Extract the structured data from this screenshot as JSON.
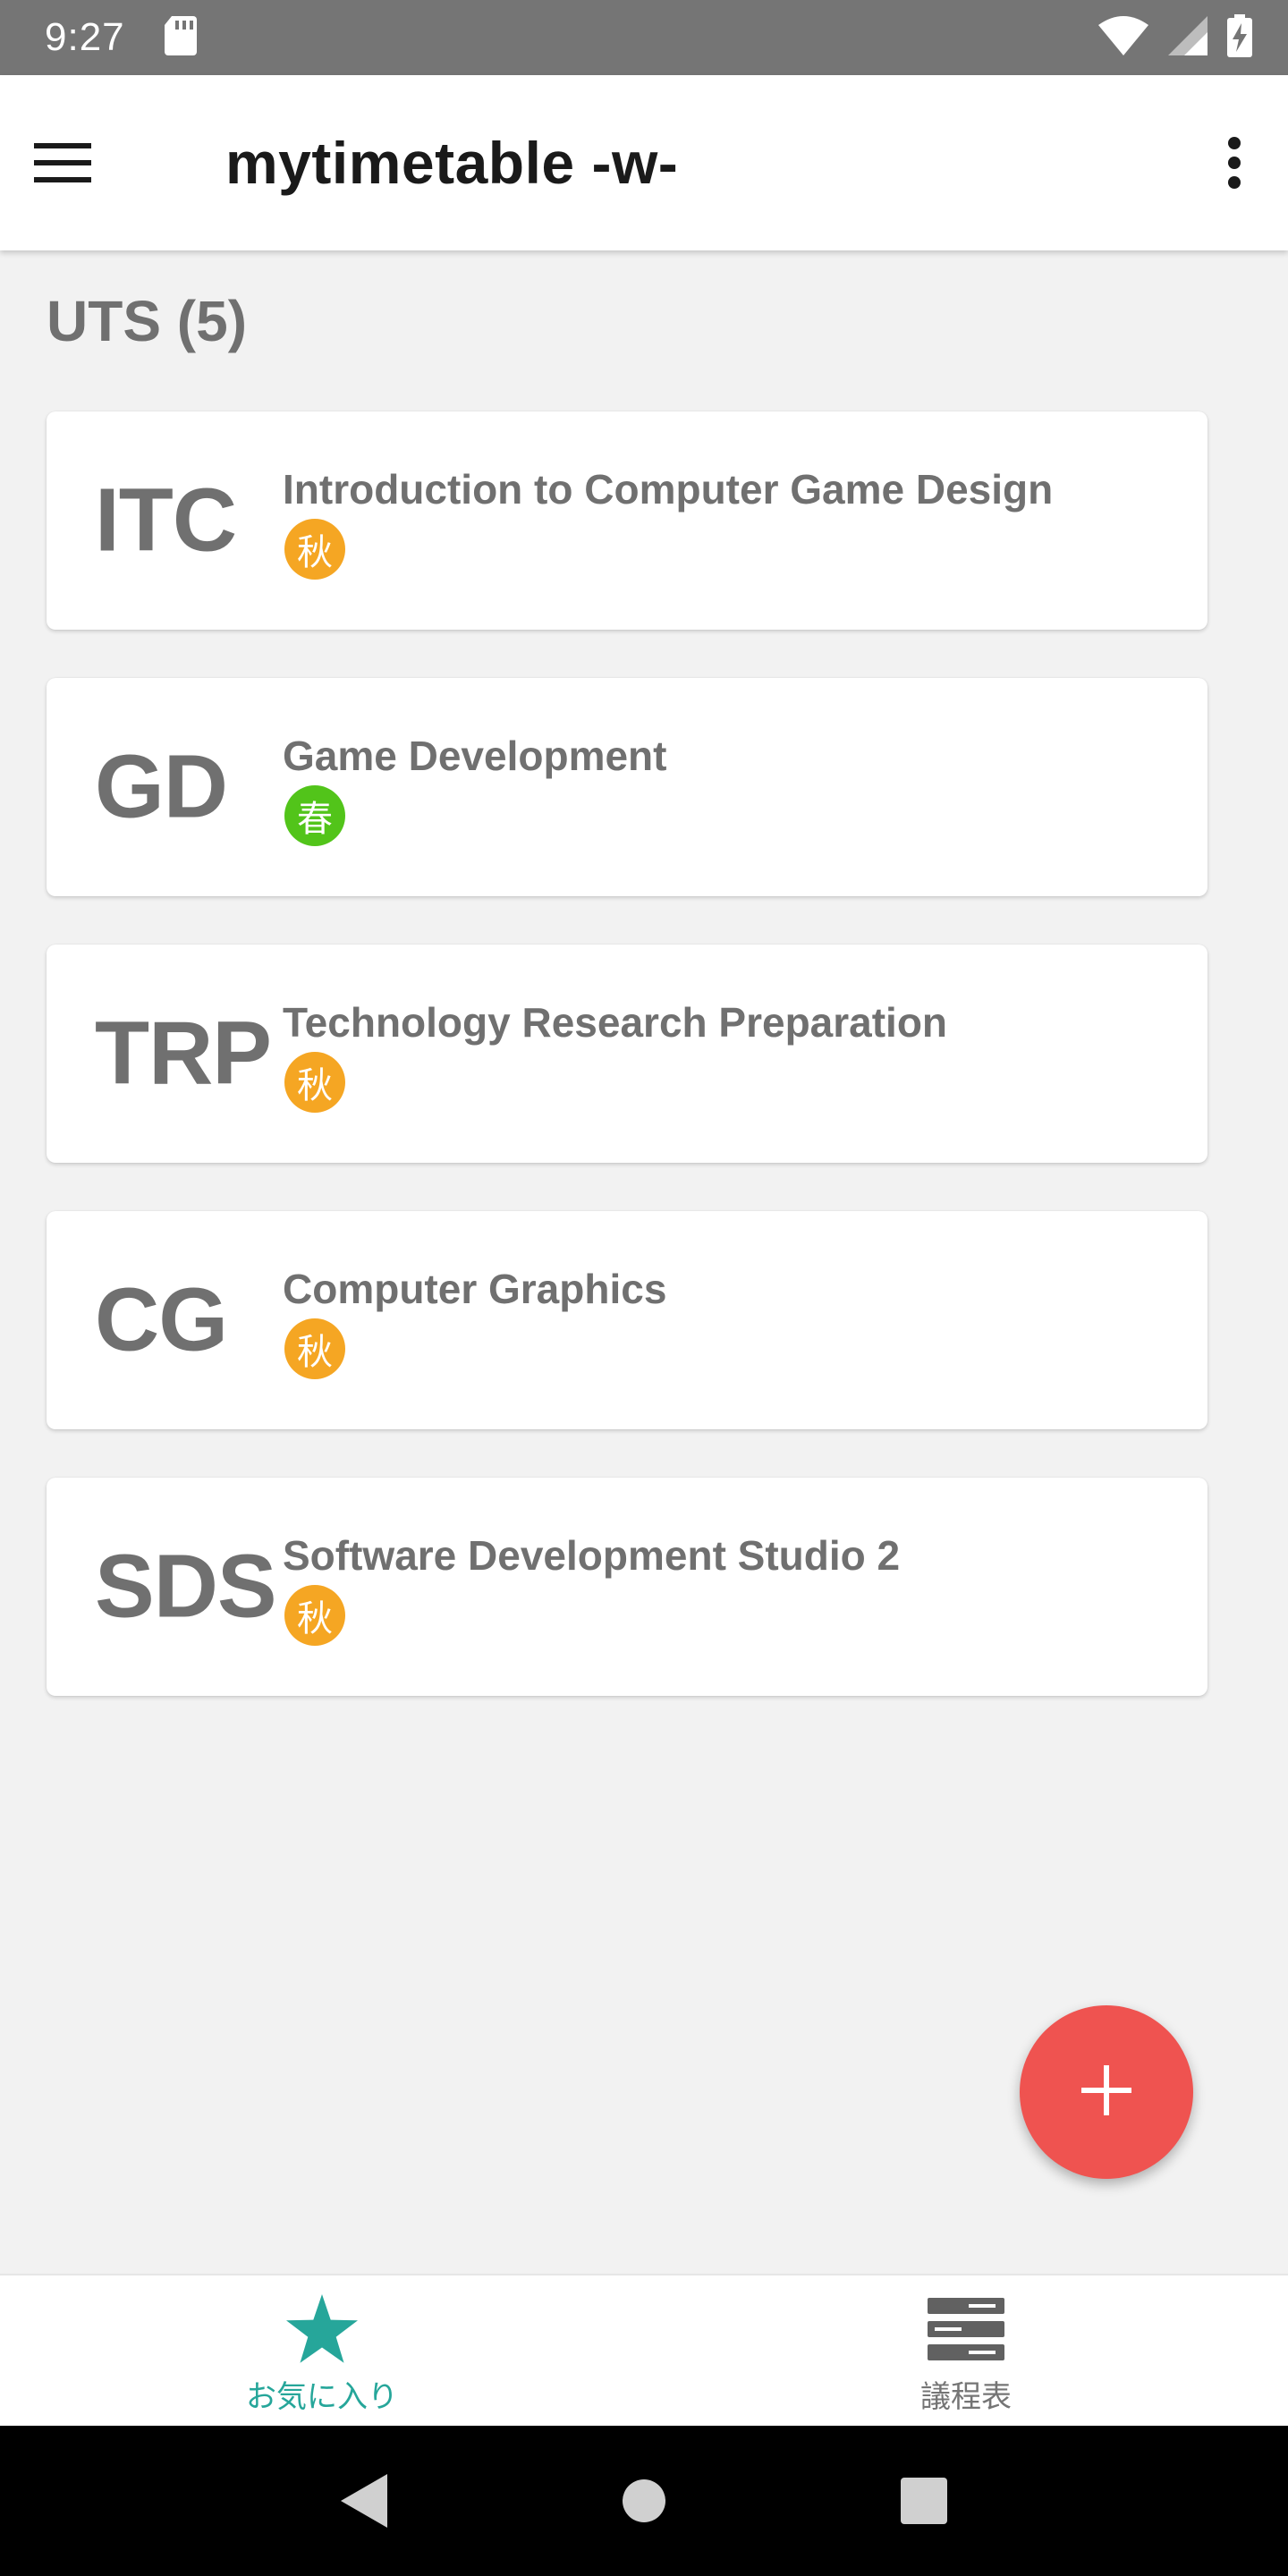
{
  "status_bar": {
    "time": "9:27",
    "icons": [
      "sd-card-icon",
      "wifi-icon",
      "cell-signal-icon",
      "battery-charging-icon"
    ]
  },
  "app_bar": {
    "title": "mytimetable -w-",
    "menu_icon": "hamburger-menu-icon",
    "more_icon": "more-vert-icon"
  },
  "section": {
    "title": "UTS (5)"
  },
  "season_colors": {
    "autumn": "#f5a623",
    "spring": "#52c41a"
  },
  "courses": [
    {
      "abbr": "ITC",
      "name": "Introduction to Computer Game Design",
      "season": "秋",
      "season_key": "autumn"
    },
    {
      "abbr": "GD",
      "name": "Game Development",
      "season": "春",
      "season_key": "spring"
    },
    {
      "abbr": "TRP",
      "name": "Technology Research Preparation",
      "season": "秋",
      "season_key": "autumn"
    },
    {
      "abbr": "CG",
      "name": "Computer Graphics",
      "season": "秋",
      "season_key": "autumn"
    },
    {
      "abbr": "SDS",
      "name": "Software Development Studio 2",
      "season": "秋",
      "season_key": "autumn"
    }
  ],
  "fab": {
    "icon": "plus-icon",
    "color": "#ef5350"
  },
  "bottom_nav": {
    "items": [
      {
        "label": "お気に入り",
        "icon": "star-icon",
        "active": true
      },
      {
        "label": "議程表",
        "icon": "list-icon",
        "active": false
      }
    ],
    "active_color": "#26a69a",
    "inactive_color": "#757575"
  },
  "system_nav": [
    "back-icon",
    "home-icon",
    "recents-icon"
  ]
}
